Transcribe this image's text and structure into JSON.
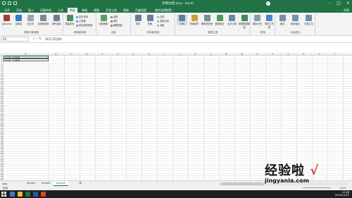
{
  "window": {
    "title": "示例文档.xlsx - Excel",
    "user_initials": "A",
    "share_label": "共享"
  },
  "tabs": [
    "文件",
    "开始",
    "插入",
    "页面布局",
    "公式",
    "数据",
    "审阅",
    "视图",
    "开发工具",
    "帮助",
    "百度网盘"
  ],
  "active_tab": "数据",
  "tell_me": "操作说明搜索",
  "ribbon": {
    "groups": [
      {
        "label": "获取外部数据",
        "buttons": [
          "自Access",
          "自网站",
          "自文本",
          "自其他来源",
          "现有连接"
        ]
      },
      {
        "label": "获取和转换",
        "buttons": [
          "新建查询"
        ],
        "mini": [
          "显示查询",
          "从表格",
          "最近使用的源"
        ]
      },
      {
        "label": "连接",
        "buttons": [
          "全部刷新"
        ],
        "mini": [
          "连接",
          "属性",
          "编辑链接"
        ]
      },
      {
        "label": "排序和筛选",
        "buttons": [
          "排序",
          "筛选"
        ],
        "mini": [
          "清除",
          "重新应用",
          "高级"
        ]
      },
      {
        "label": "数据工具",
        "buttons": [
          "分列",
          "快速填充",
          "删除重复值",
          "数据验证",
          "合并计算",
          "管理数据模型"
        ]
      },
      {
        "label": "预测",
        "buttons": [
          "模拟分析",
          "预测工作表"
        ]
      },
      {
        "label": "分级显示",
        "buttons": [
          "组合",
          "取消组合",
          "分类汇总"
        ]
      }
    ]
  },
  "formula_bar": {
    "name_box": "A1",
    "fx": "fx",
    "content": "11月 15日吗"
  },
  "columns": [
    "A",
    "B",
    "C",
    "D",
    "E",
    "F",
    "G",
    "H",
    "I",
    "J",
    "K",
    "L",
    "M",
    "N",
    "O",
    "P",
    "Q",
    "R",
    "S",
    "T"
  ],
  "cells": {
    "A1": "11月 15日吗",
    "A2": "12月 11日吗"
  },
  "sheets": [
    "Sheet1",
    "Sheet2",
    "Sheet3"
  ],
  "active_sheet": "Sheet3",
  "status": {
    "ready": "就绪",
    "zoom": "100%"
  },
  "taskbar": {
    "time": "15:06",
    "date": "2019/11/15"
  },
  "watermark": {
    "text": "经验啦",
    "check": "√",
    "url": "jingyanla.com"
  },
  "colors": {
    "excel_green": "#217346",
    "watermark_check": "#e23b3b"
  }
}
